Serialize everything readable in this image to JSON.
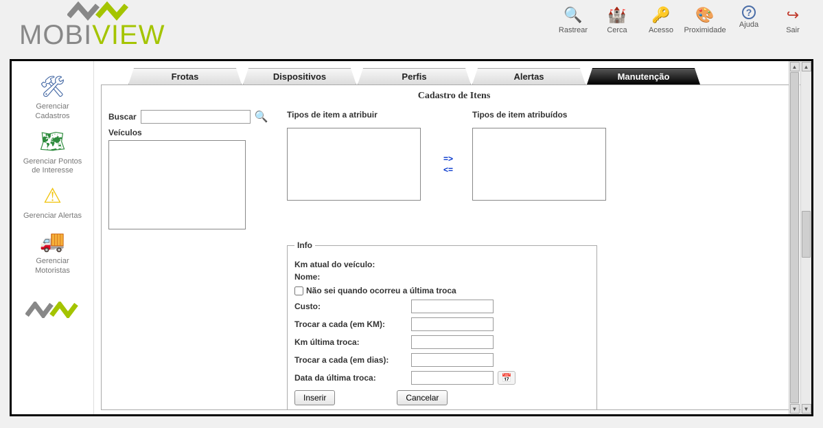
{
  "logo": {
    "part1": "MOBI",
    "part2": "VIEW"
  },
  "toolbar": [
    {
      "key": "rastrear",
      "label": "Rastrear",
      "icon": "🔍"
    },
    {
      "key": "cerca",
      "label": "Cerca",
      "icon": "🏰"
    },
    {
      "key": "acesso",
      "label": "Acesso",
      "icon": "🔑"
    },
    {
      "key": "proximidade",
      "label": "Proximidade",
      "icon": "🎨"
    },
    {
      "key": "ajuda",
      "label": "Ajuda",
      "icon": "?"
    },
    {
      "key": "sair",
      "label": "Sair",
      "icon": "↪"
    }
  ],
  "sidebar": [
    {
      "key": "cadastros",
      "label": "Gerenciar Cadastros",
      "icon": "🛠"
    },
    {
      "key": "pontos",
      "label": "Gerenciar Pontos de Interesse",
      "icon": "🗺"
    },
    {
      "key": "alertas",
      "label": "Gerenciar Alertas",
      "icon": "⚠"
    },
    {
      "key": "motoristas",
      "label": "Gerenciar Motoristas",
      "icon": "🚚"
    }
  ],
  "tabs": {
    "frotas": "Frotas",
    "dispositivos": "Dispositivos",
    "perfis": "Perfis",
    "alertas": "Alertas",
    "manutencao": "Manutenção",
    "active": "manutencao"
  },
  "panel": {
    "title": "Cadastro de Itens",
    "buscar_label": "Buscar",
    "veiculos_label": "Veículos",
    "tipos_atribuir_label": "Tipos de item a atribuir",
    "tipos_atribuidos_label": "Tipos de item atribuídos",
    "info_legend": "Info",
    "km_atual_label": "Km atual do veículo:",
    "nome_label": "Nome:",
    "nao_sei_label": "Não sei quando ocorreu a última troca",
    "custo_label": "Custo:",
    "trocar_km_label": "Trocar a cada (em KM):",
    "km_ultima_label": "Km última troca:",
    "trocar_dias_label": "Trocar a cada (em dias):",
    "data_ultima_label": "Data da última troca:",
    "inserir_btn": "Inserir",
    "cancelar_btn": "Cancelar",
    "arrow_right": "=>",
    "arrow_left": "<="
  }
}
